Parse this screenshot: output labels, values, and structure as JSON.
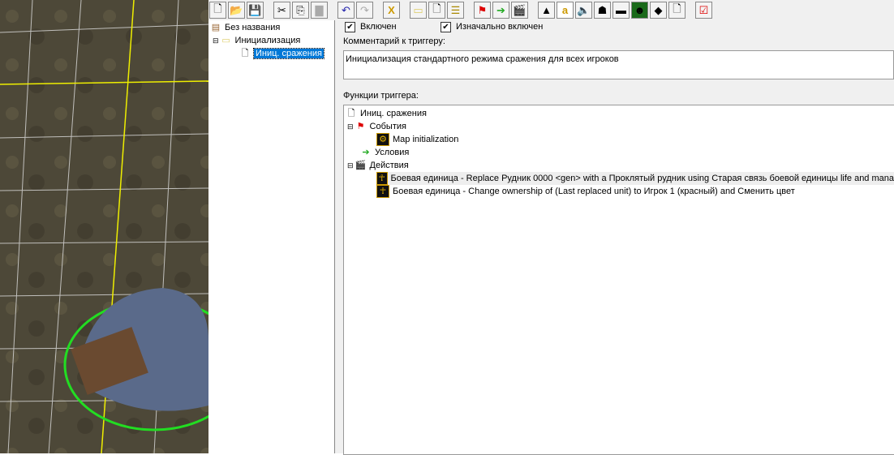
{
  "toolbar": {
    "buttons": [
      "new-icon",
      "open-icon",
      "save-icon",
      "cut-icon",
      "copy-icon",
      "paste-icon",
      "undo-icon",
      "redo-icon",
      "delete-icon",
      "new-category-icon",
      "new-trigger-icon",
      "new-comment-icon",
      "new-event-icon",
      "new-condition-icon",
      "new-action-icon",
      "terrain-editor-icon",
      "trigger-editor-icon",
      "sound-editor-icon",
      "object-editor-icon",
      "campaign-editor-icon",
      "ai-editor-icon",
      "object-manager-icon",
      "import-manager-icon",
      "test-map-icon"
    ]
  },
  "tree": {
    "root": "Без названия",
    "category": "Инициализация",
    "trigger": "Иниц. сражения"
  },
  "trigger": {
    "enabled_label": "Включен",
    "initially_on_label": "Изначально включен",
    "comment_label": "Комментарий к триггеру:",
    "comment": "Инициализация стандартного режима сражения для всех игроков",
    "functions_label": "Функции триггера:",
    "functions": {
      "name": "Иниц. сражения",
      "events": "События",
      "event1": "Map initialization",
      "conditions": "Условия",
      "actions": "Действия",
      "action1": "Боевая единица - Replace Рудник 0000 <gen> with a Проклятый рудник using Старая связь боевой единицы life and mana",
      "action2": "Боевая единица - Change ownership of (Last replaced unit) to Игрок 1 (красный) and Сменить цвет"
    }
  }
}
